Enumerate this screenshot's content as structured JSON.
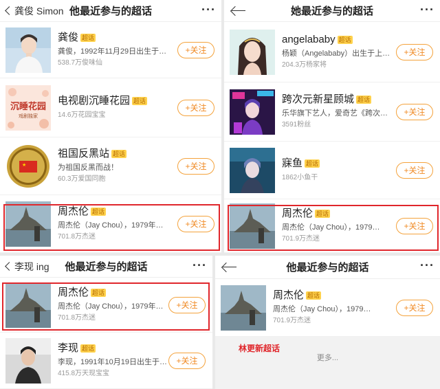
{
  "follow_label": "+关注",
  "badge_label": "超话",
  "more_dots": "···",
  "p1": {
    "back_label": "龚俊 Simon",
    "title": "他最近参与的超话",
    "items": [
      {
        "name": "龚俊",
        "desc": "龚俊，1992年11月29日出生于…",
        "fans": "538.7万俊味仙"
      },
      {
        "name": "电视剧沉睡花园",
        "desc": "",
        "fans": "14.6万花园宝宝",
        "thumb_text": "沉睡花园",
        "thumb_sub": "戏剧独家"
      },
      {
        "name": "祖国反黑站",
        "desc": "为祖国反黑而战！",
        "fans": "60.3万爱国同胞"
      },
      {
        "name": "周杰伦",
        "desc": "周杰伦（Jay Chou），1979年…",
        "fans": "701.8万杰迷"
      }
    ]
  },
  "p2": {
    "title": "她最近参与的超话",
    "items": [
      {
        "name": "angelababy",
        "desc": "杨颖（Angelababy）出生于上…",
        "fans": "204.3万杨家将"
      },
      {
        "name": "跨次元新星顾城",
        "desc": "乐华旗下艺人，爱奇艺《跨次…",
        "fans": "3591粉丝"
      },
      {
        "name": "寐鱼",
        "desc": "",
        "fans": "1862小鱼干"
      },
      {
        "name": "周杰伦",
        "desc": "周杰伦（Jay Chou），1979…",
        "fans": "701.9万杰迷"
      }
    ]
  },
  "p3": {
    "back_label": "李现 ing",
    "title": "他最近参与的超话",
    "items": [
      {
        "name": "周杰伦",
        "desc": "周杰伦（Jay Chou），1979年…",
        "fans": "701.8万杰迷"
      },
      {
        "name": "李现",
        "desc": "李现，1991年10月19日出生于…",
        "fans": "415.8万天现宝宝"
      }
    ]
  },
  "p4": {
    "title": "他最近参与的超话",
    "items": [
      {
        "name": "周杰伦",
        "desc": "周杰伦（Jay Chou），1979…",
        "fans": "701.9万杰迷"
      }
    ],
    "footer_red": "林更新超话",
    "footer_more": "更多..."
  }
}
